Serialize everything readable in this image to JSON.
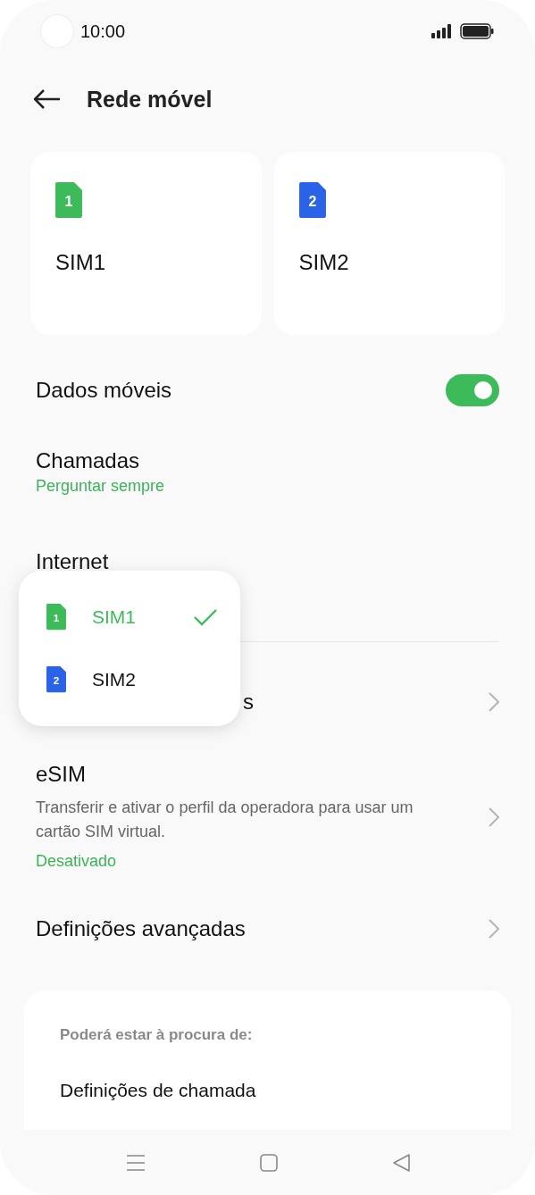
{
  "status_bar": {
    "time": "10:00"
  },
  "header": {
    "title": "Rede móvel"
  },
  "sim_cards": [
    {
      "number": "1",
      "label": "SIM1",
      "color": "#3dbb5a"
    },
    {
      "number": "2",
      "label": "SIM2",
      "color": "#2a62e8"
    }
  ],
  "settings": [
    {
      "kind": "toggle",
      "label": "Dados móveis",
      "on": true
    },
    {
      "kind": "value",
      "label": "Chamadas",
      "value": "Perguntar sempre"
    },
    {
      "kind": "value",
      "label": "Internet"
    },
    {
      "kind": "covered",
      "label": "s"
    },
    {
      "kind": "link",
      "label": "eSIM",
      "description": "Transferir e ativar o perfil da operadora para usar um cartão SIM virtual.",
      "value": "Desativado"
    },
    {
      "kind": "link",
      "label": "Definições avançadas"
    }
  ],
  "sim_menu": {
    "items": [
      {
        "number": "1",
        "label": "SIM1",
        "selected": true,
        "color": "#3dbb5a"
      },
      {
        "number": "2",
        "label": "SIM2",
        "selected": false,
        "color": "#2a62e8"
      }
    ]
  },
  "suggestions": {
    "heading": "Poderá estar à procura de:",
    "items": [
      "Definições de chamada"
    ]
  }
}
